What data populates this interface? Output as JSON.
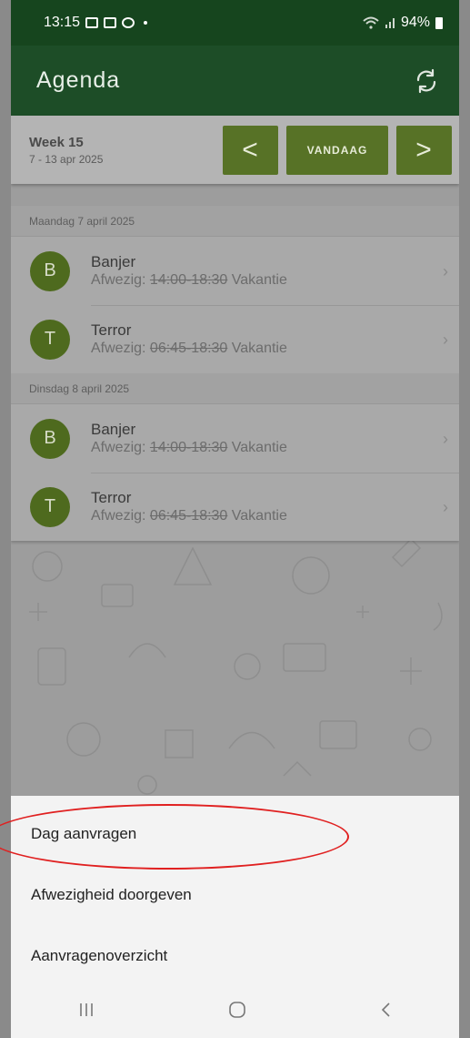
{
  "status_bar": {
    "time": "13:15",
    "battery": "94%"
  },
  "app_bar": {
    "title": "Agenda"
  },
  "week": {
    "label": "Week 15",
    "range": "7 - 13 apr 2025",
    "prev_label": "<",
    "today_label": "VANDAAG",
    "next_label": ">"
  },
  "days": [
    {
      "header": "Maandag 7 april 2025",
      "entries": [
        {
          "initial": "B",
          "name": "Banjer",
          "prefix": "Afwezig:",
          "time": "14:00-18:30",
          "reason": "Vakantie"
        },
        {
          "initial": "T",
          "name": "Terror",
          "prefix": "Afwezig:",
          "time": "06:45-18:30",
          "reason": "Vakantie"
        }
      ]
    },
    {
      "header": "Dinsdag 8 april 2025",
      "entries": [
        {
          "initial": "B",
          "name": "Banjer",
          "prefix": "Afwezig:",
          "time": "14:00-18:30",
          "reason": "Vakantie"
        },
        {
          "initial": "T",
          "name": "Terror",
          "prefix": "Afwezig:",
          "time": "06:45-18:30",
          "reason": "Vakantie"
        }
      ]
    }
  ],
  "menu": {
    "items": [
      "Dag aanvragen",
      "Afwezigheid doorgeven",
      "Aanvragenoverzicht"
    ]
  },
  "colors": {
    "app_bar": "#1d4d27",
    "status_bar": "#16451e",
    "accent": "#577226",
    "avatar": "#4e6a1e",
    "highlight_circle": "#e02020"
  },
  "icons": {
    "refresh": "refresh-icon",
    "chevron": "chevron-right-icon",
    "nav_recent": "recent-apps-icon",
    "nav_home": "home-icon",
    "nav_back": "back-icon"
  }
}
